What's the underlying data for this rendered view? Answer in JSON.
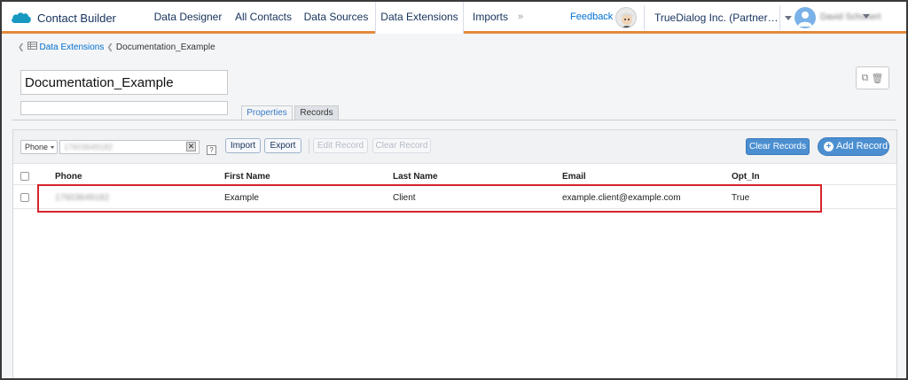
{
  "app": {
    "title": "Contact Builder",
    "nav_tabs": [
      {
        "label": "Data Designer"
      },
      {
        "label": "All Contacts"
      },
      {
        "label": "Data Sources"
      },
      {
        "label": "Data Extensions",
        "active": true
      },
      {
        "label": "Imports"
      }
    ],
    "more_chevron": "»",
    "feedback": "Feedback",
    "org_name": "TrueDialog Inc. (Partner…",
    "user_name": "David Schonert",
    "accent_color": "#e28a3c"
  },
  "breadcrumb": {
    "root": "Data Extensions",
    "current": "Documentation_Example"
  },
  "data_extension": {
    "name": "Documentation_Example",
    "description": ""
  },
  "subtabs": [
    {
      "label": "Properties"
    },
    {
      "label": "Records",
      "active": true
    }
  ],
  "toolbar": {
    "filter_field": "Phone",
    "filter_value": "17603649182",
    "clear_symbol": "✕",
    "help_symbol": "?",
    "import_label": "Import",
    "export_label": "Export",
    "edit_record_label": "Edit Record",
    "clear_record_label": "Clear Record",
    "clear_records_label": "Clear Records",
    "add_record_label": "Add Record"
  },
  "grid": {
    "columns": [
      "Phone",
      "First Name",
      "Last Name",
      "Email",
      "Opt_In"
    ],
    "rows": [
      {
        "phone": "17603649182",
        "first_name": "Example",
        "last_name": "Client",
        "email": "example.client@example.com",
        "opt_in": "True"
      }
    ]
  }
}
